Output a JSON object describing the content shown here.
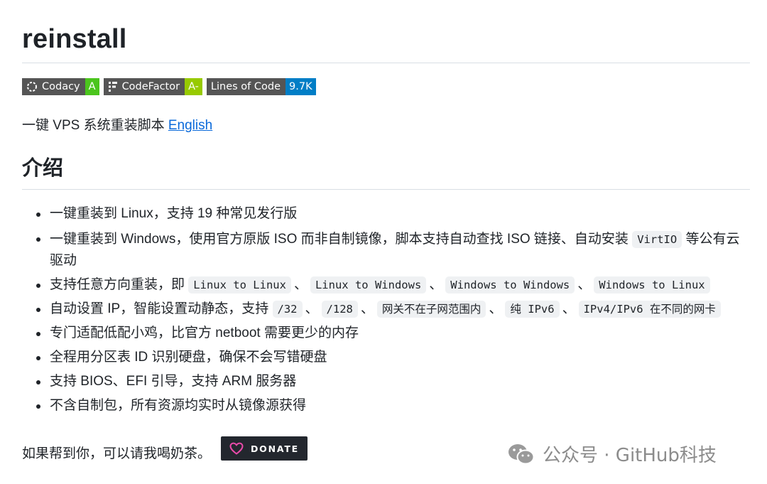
{
  "title": "reinstall",
  "badges": [
    {
      "label": "Codacy",
      "value": "A",
      "value_color": "#4bc51d",
      "icon": "codacy-icon"
    },
    {
      "label": "CodeFactor",
      "value": "A-",
      "value_color": "#97ca00",
      "icon": "codefactor-icon"
    },
    {
      "label": "Lines of Code",
      "value": "9.7K",
      "value_color": "#007ec6",
      "icon": ""
    }
  ],
  "lead": {
    "text": "一键 VPS 系统重装脚本 ",
    "link": "English",
    "link_color": "#0969da"
  },
  "intro": {
    "heading": "介绍",
    "items": {
      "i1": "一键重装到 Linux，支持 19 种常见发行版",
      "i2_a": "一键重装到 Windows，使用官方原版 ISO 而非自制镜像，脚本支持自动查找 ISO 链接、自动安装",
      "i2_code": "VirtIO",
      "i2_b": "等公有云驱动",
      "i3_a": "支持任意方向重装，即",
      "i3_codes": [
        "Linux to Linux",
        "Linux to Windows",
        "Windows to Windows",
        "Windows to Linux"
      ],
      "i4_a": "自动设置 IP，智能设置动静态，支持",
      "i4_codes": [
        "/32",
        "/128",
        "网关不在子网范围内",
        "纯 IPv6",
        "IPv4/IPv6 在不同的网卡"
      ],
      "i5": "专门适配低配小鸡，比官方 netboot 需要更少的内存",
      "i6": "全程用分区表 ID 识别硬盘，确保不会写错硬盘",
      "i7": "支持 BIOS、EFI 引导，支持 ARM 服务器",
      "i8": "不含自制包，所有资源均实时从镜像源获得",
      "sep": "、"
    }
  },
  "donate": {
    "text": "如果帮到你，可以请我喝奶茶。",
    "button": "DONATE",
    "icon": "heart-icon",
    "icon_color": "#ea4aaa"
  },
  "watermark": {
    "text": "公众号 · GitHub科技",
    "icon": "wechat-icon"
  }
}
